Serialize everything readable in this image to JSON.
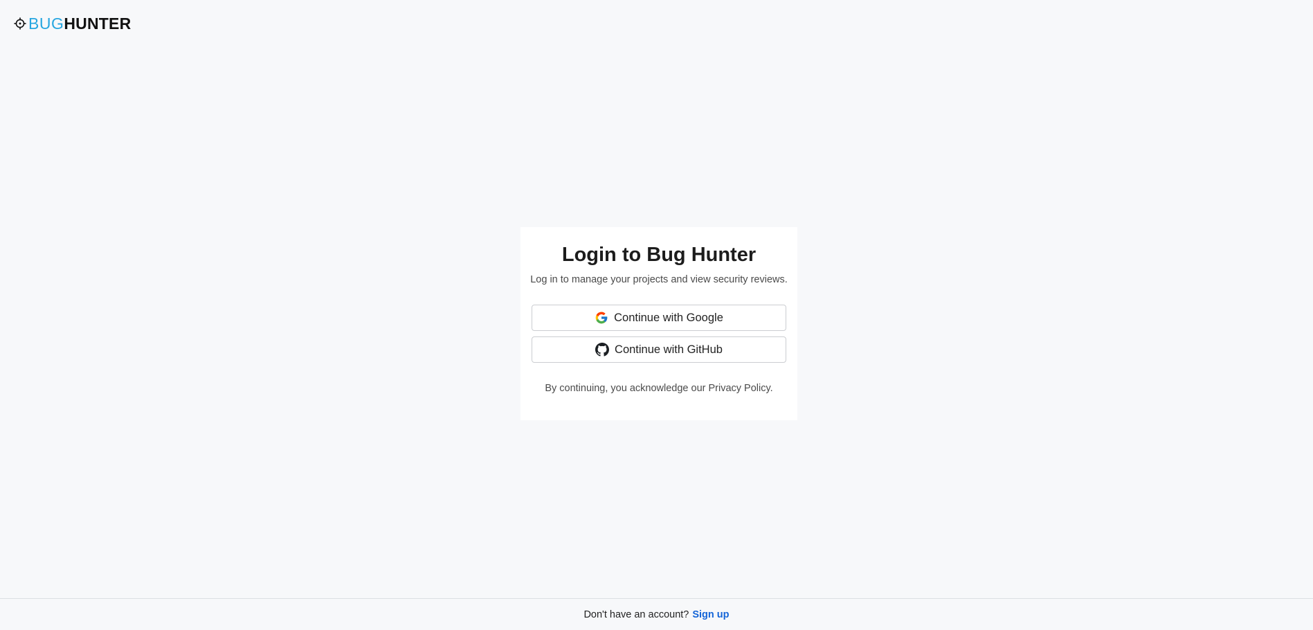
{
  "header": {
    "logo_part1": "BUG",
    "logo_part2": "HUNTER",
    "brand_color": "#27a6e0"
  },
  "login_card": {
    "title": "Login to Bug Hunter",
    "subtitle": "Log in to manage your projects and view security reviews.",
    "google_button": {
      "label": "Continue with Google",
      "icon": "google-icon"
    },
    "github_button": {
      "label": "Continue with GitHub",
      "icon": "github-icon"
    },
    "note": "By continuing, you acknowledge our Privacy Policy."
  },
  "footer": {
    "prompt": "Don't have an account?",
    "signup_label": "Sign up",
    "link_color": "#1565d8"
  }
}
